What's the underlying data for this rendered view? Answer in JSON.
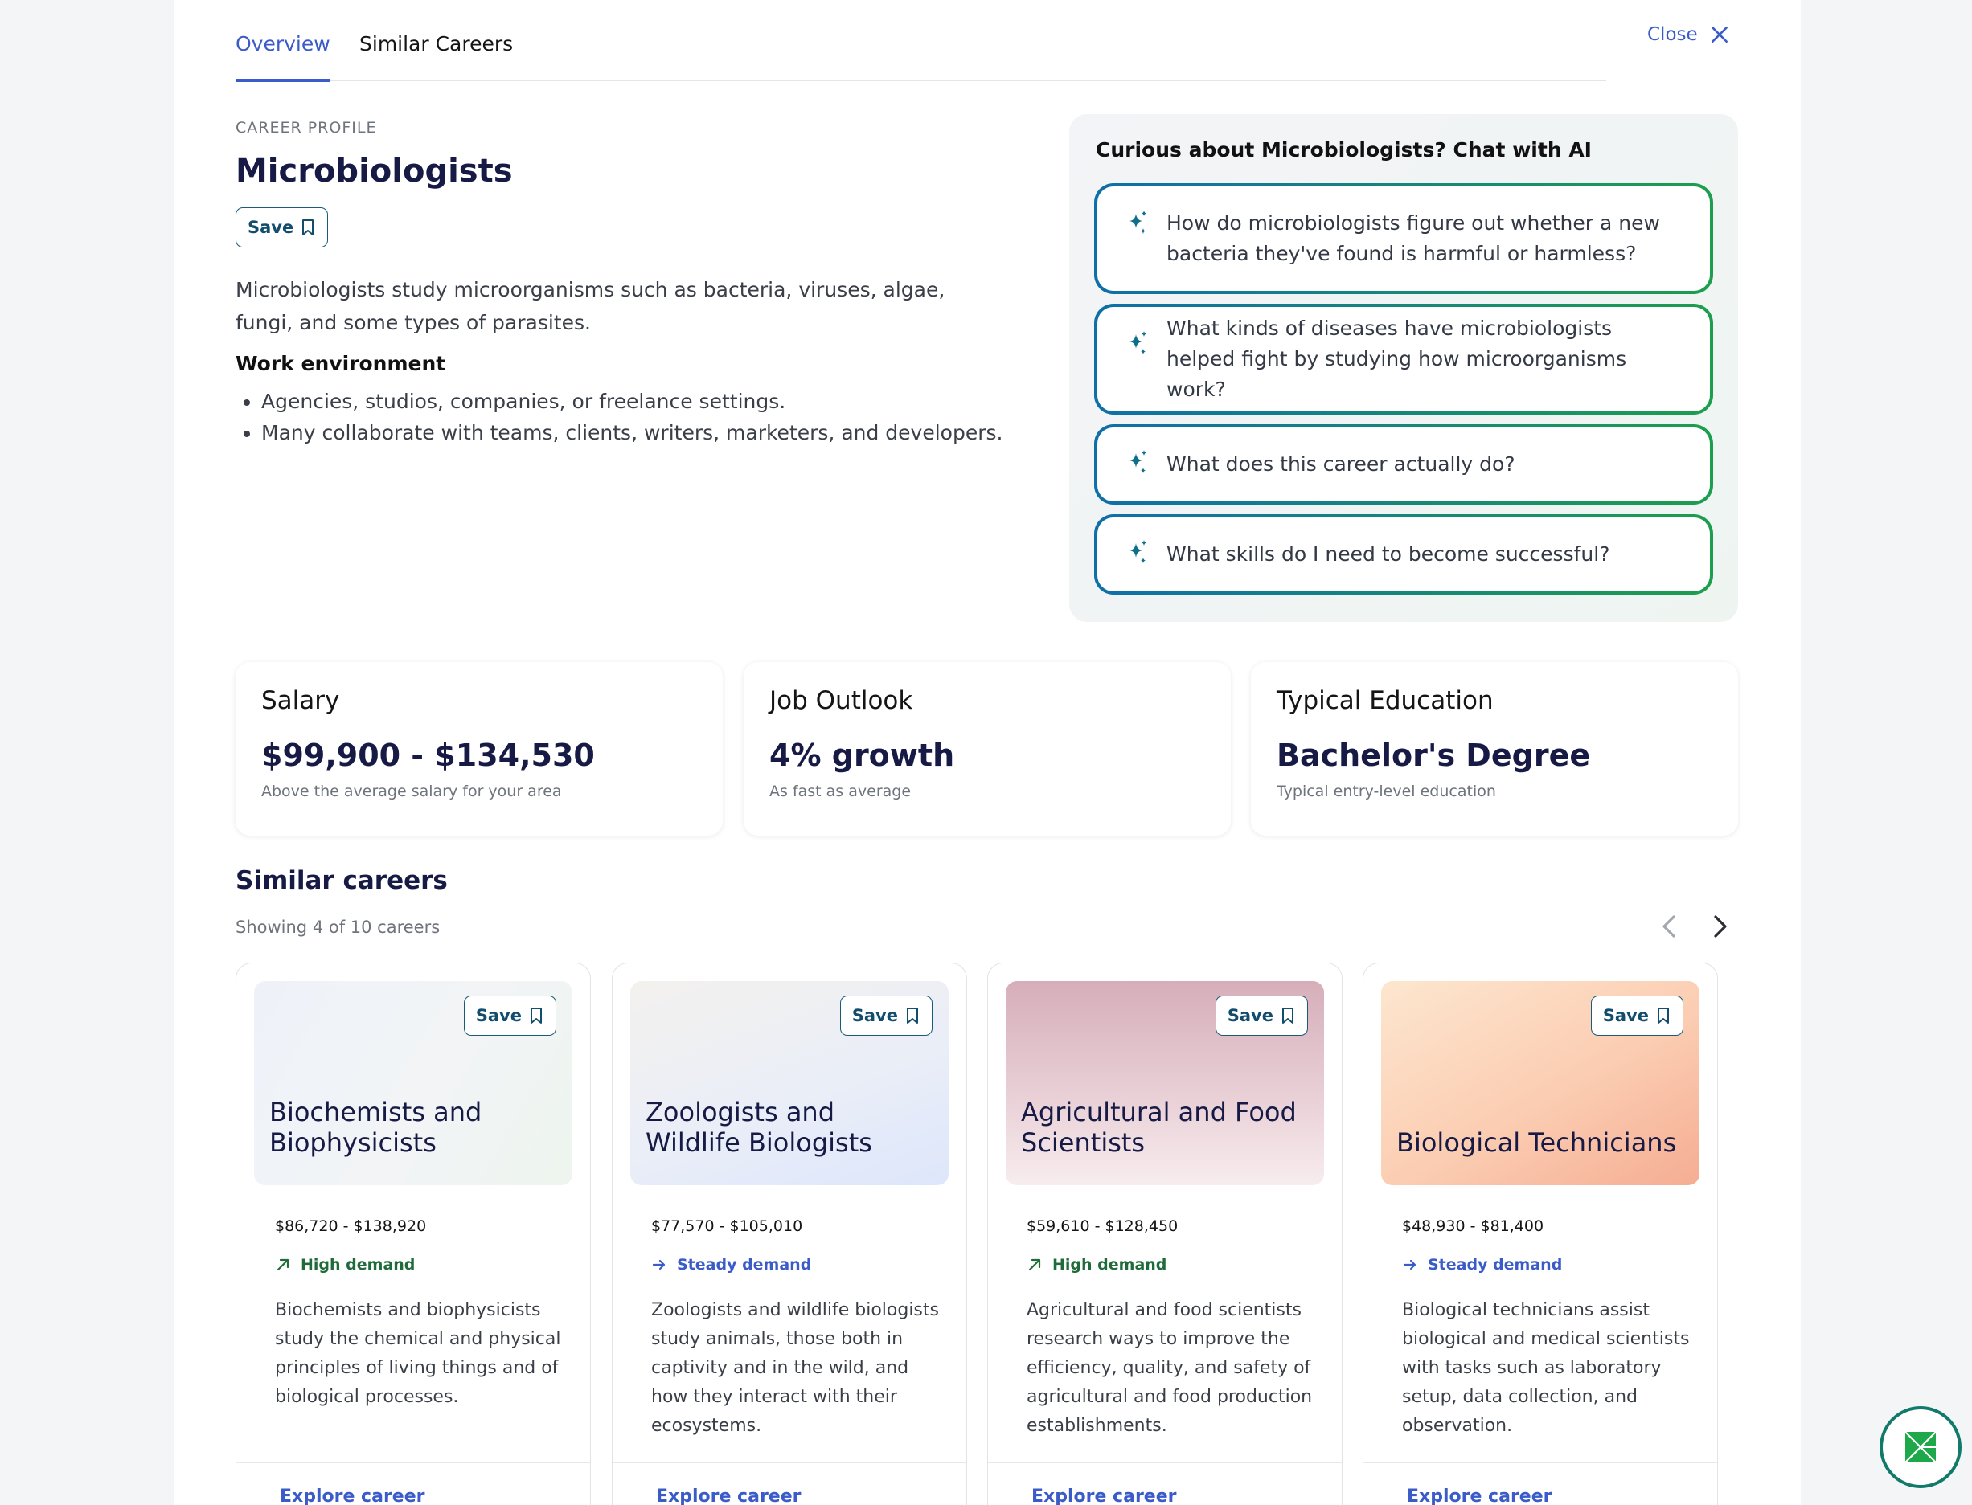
{
  "tabs": [
    {
      "label": "Overview",
      "active": true
    },
    {
      "label": "Similar Careers",
      "active": false
    }
  ],
  "close_label": "Close",
  "profile": {
    "eyebrow": "CAREER PROFILE",
    "title": "Microbiologists",
    "save_label": "Save",
    "description": "Microbiologists study microorganisms such as bacteria, viruses, algae, fungi, and some types of parasites.",
    "work_env_title": "Work environment",
    "work_env_items": [
      "Agencies, studios, companies, or freelance settings.",
      "Many collaborate with teams, clients, writers, marketers, and developers."
    ]
  },
  "chat": {
    "title": "Curious about Microbiologists? Chat with AI",
    "prompts": [
      "How do microbiologists figure out whether a new bacteria they've found is harmful or harmless?",
      "What kinds of diseases have microbiologists helped fight by studying how microorganisms work?",
      "What does this career actually do?",
      "What skills do I need to become successful?"
    ]
  },
  "stats": [
    {
      "label": "Salary",
      "value": "$99,900 - $134,530",
      "sub": "Above the average salary for your area"
    },
    {
      "label": "Job Outlook",
      "value": "4% growth",
      "sub": "As fast as average"
    },
    {
      "label": "Typical Education",
      "value": "Bachelor's Degree",
      "sub": "Typical entry-level education"
    }
  ],
  "similar": {
    "title": "Similar careers",
    "showing": "Showing 4 of 10 careers",
    "cards": [
      {
        "name": "Biochemists and Biophysicists",
        "salary": "$86,720 - $138,920",
        "demand": "High demand",
        "description": "Biochemists and biophysicists study the chemical and physical principles of living things and of biological processes.",
        "save_label": "Save",
        "link": "Explore career"
      },
      {
        "name": "Zoologists and Wildlife Biologists",
        "salary": "$77,570 - $105,010",
        "demand": "Steady demand",
        "description": "Zoologists and wildlife biologists study animals, those both in captivity and in the wild, and how they interact with their ecosystems.",
        "save_label": "Save",
        "link": "Explore career"
      },
      {
        "name": "Agricultural and Food Scientists",
        "salary": "$59,610 - $128,450",
        "demand": "High demand",
        "description": "Agricultural and food scientists research ways to improve the efficiency, quality, and safety of agricultural and food production establishments.",
        "save_label": "Save",
        "link": "Explore career"
      },
      {
        "name": "Biological Technicians",
        "salary": "$48,930 - $81,400",
        "demand": "Steady demand",
        "description": "Biological technicians assist biological and medical scientists with tasks such as laboratory setup, data collection, and observation.",
        "save_label": "Save",
        "link": "Explore career"
      }
    ]
  },
  "colors": {
    "accent": "#3b5bc9",
    "navy": "#161a45",
    "high_demand": "#1f6b3a",
    "gradient_start": "#0f6fa8",
    "gradient_end": "#1d9e4d"
  },
  "icons": {
    "close": "close-icon",
    "save": "bookmark-icon",
    "prompt": "sparkle-icon",
    "high_demand": "trend-up-icon",
    "steady_demand": "arrow-right-icon",
    "prev": "chevron-left-icon",
    "next": "chevron-right-icon",
    "fab": "app-logo-icon"
  }
}
